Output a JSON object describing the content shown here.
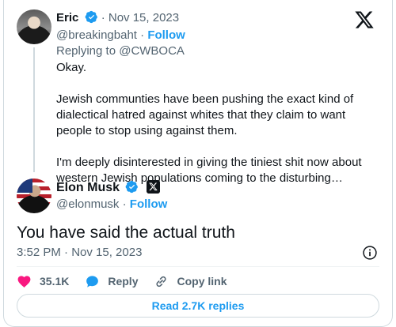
{
  "parent_tweet": {
    "display_name": "Eric",
    "separator": "·",
    "date": "Nov 15, 2023",
    "handle": "@breakingbaht",
    "follow_label": "Follow",
    "replying_to": "Replying to @CWBOCA",
    "paragraphs": [
      "Okay.",
      "Jewish communties have been pushing the exact kind of dialectical hatred against whites that they claim to want people to stop using against them.",
      "I'm deeply disinterested in giving the tiniest shit now about western Jewish populations coming to the disturbing…"
    ]
  },
  "main_tweet": {
    "display_name": "Elon Musk",
    "handle": "@elonmusk",
    "separator": "·",
    "follow_label": "Follow",
    "text": "You have said the actual truth",
    "timestamp": "3:52 PM · Nov 15, 2023"
  },
  "actions": {
    "like_count": "35.1K",
    "reply_label": "Reply",
    "copy_link_label": "Copy link"
  },
  "read_replies_label": "Read 2.7K replies",
  "colors": {
    "accent": "#1d9bf0",
    "like": "#f91880",
    "muted": "#536471",
    "text": "#0f1419",
    "border": "#cfd9de"
  },
  "icons": [
    "x-logo-icon",
    "verified-badge-icon",
    "x-affiliate-badge-icon",
    "info-icon",
    "heart-icon",
    "reply-bubble-icon",
    "link-icon"
  ]
}
